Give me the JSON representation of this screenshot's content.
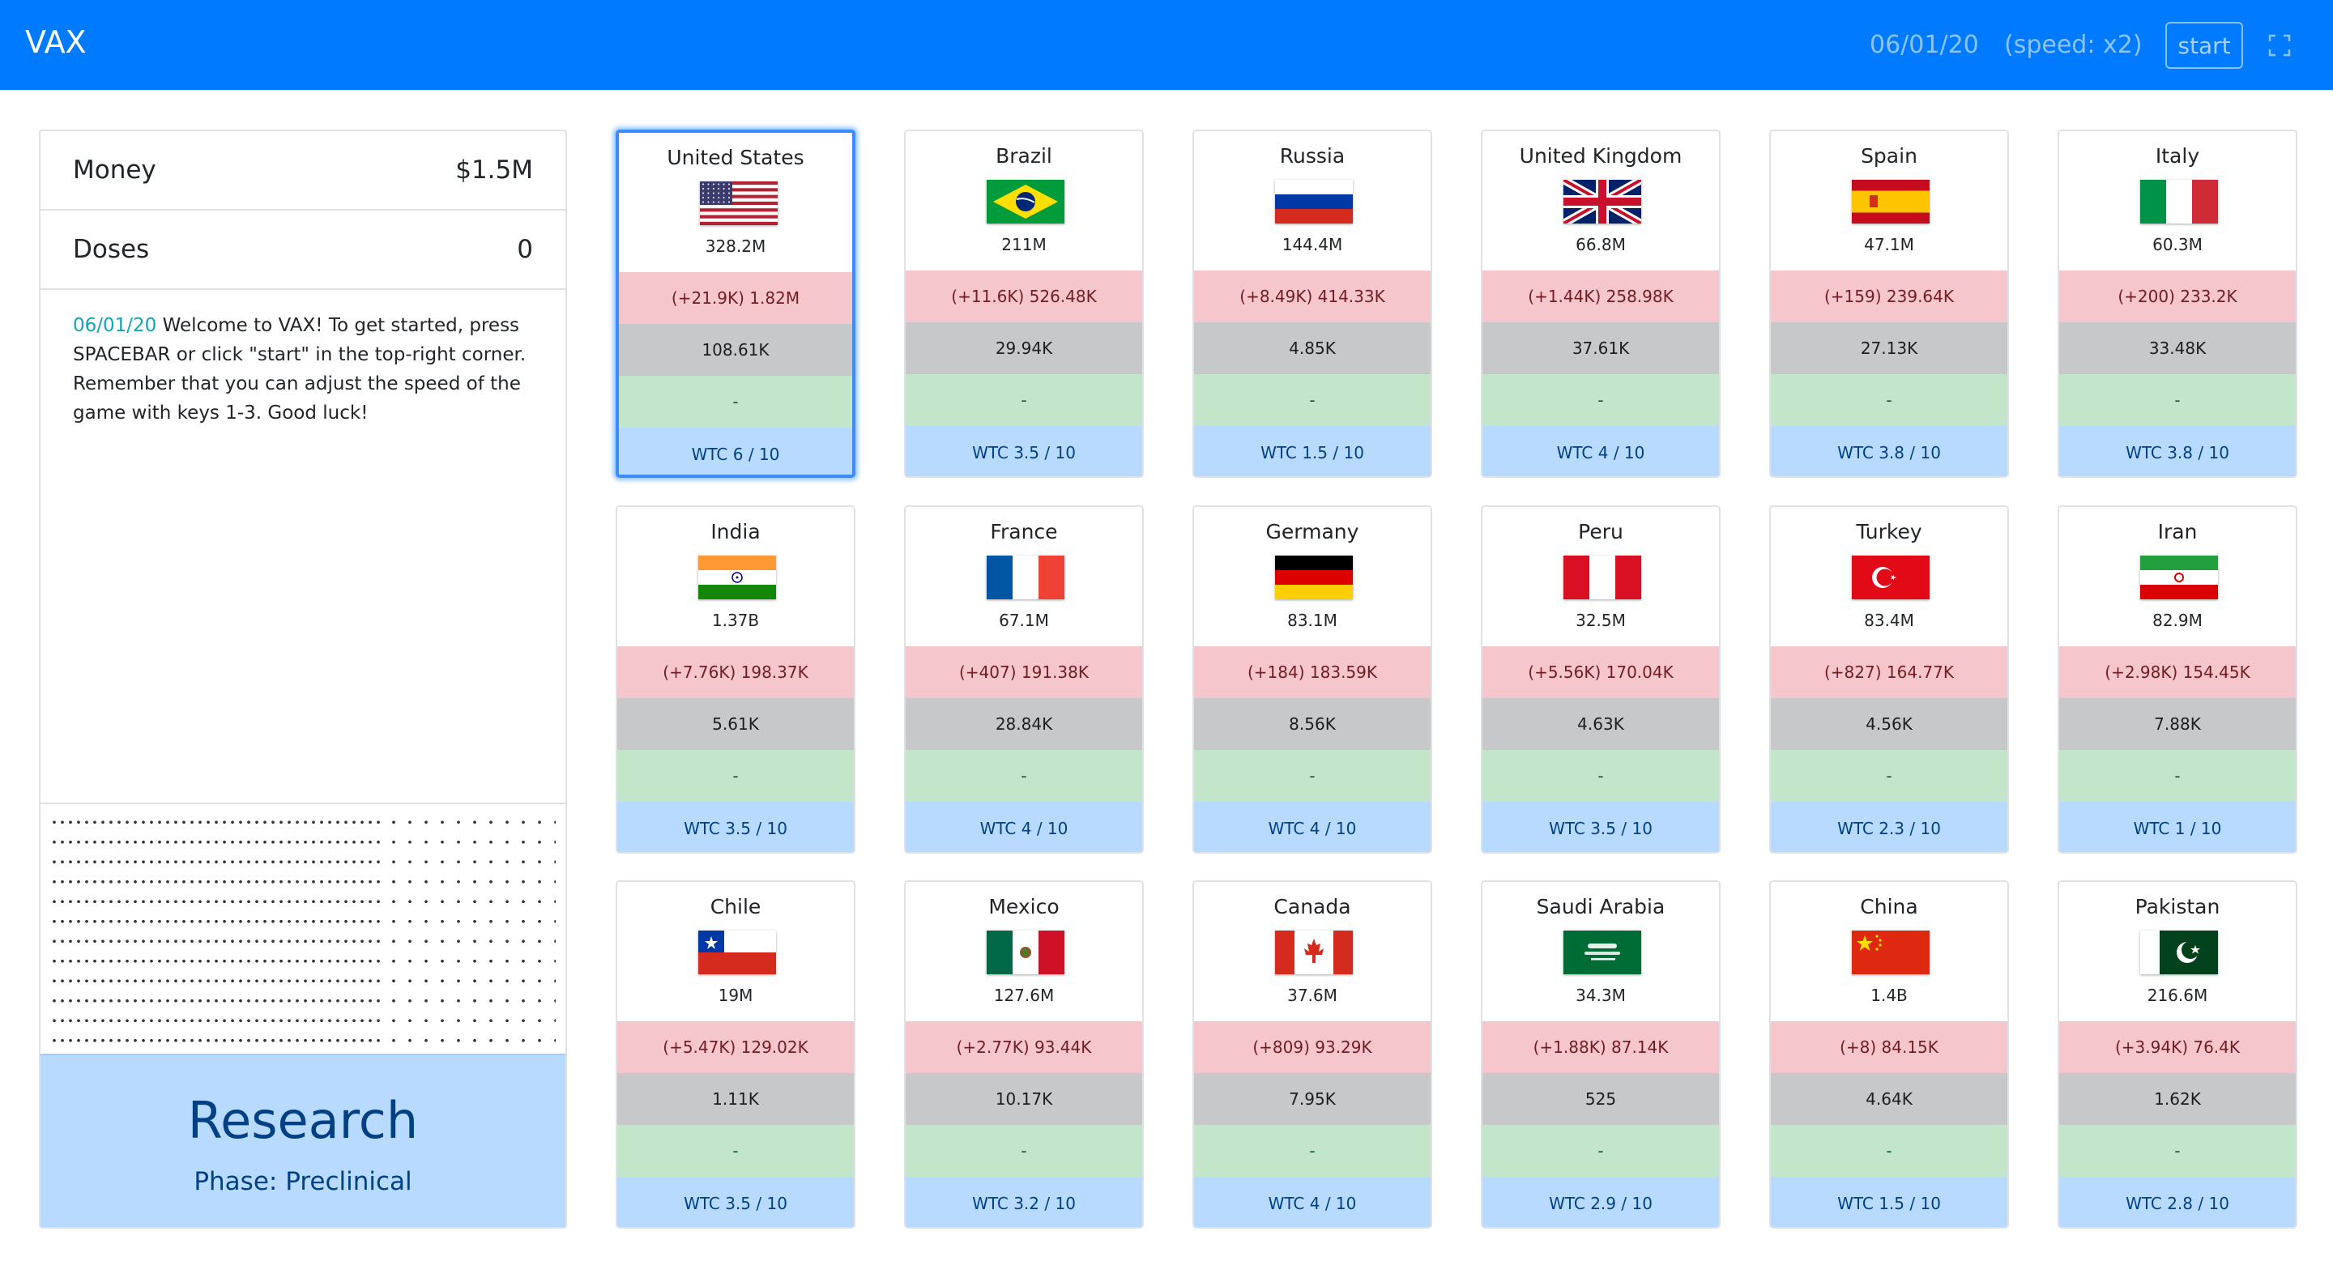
{
  "navbar": {
    "brand": "VAX",
    "date": "06/01/20",
    "speed": "(speed: x2)",
    "start_label": "start",
    "fullscreen_icon": "fullscreen-icon",
    "color": "#007bff"
  },
  "stats": {
    "money_label": "Money",
    "money_value": "$1.5M",
    "doses_label": "Doses",
    "doses_value": "0"
  },
  "log": {
    "date": "06/01/20",
    "message": " Welcome to VAX! To get started, press SPACEBAR or click \"start\" in the top-right corner. Remember that you can adjust the speed of the game with keys 1-3. Good luck!"
  },
  "research": {
    "title": "Research",
    "phase": "Phase: Preclinical"
  },
  "countries": [
    {
      "name": "United States",
      "flag": "us-flag",
      "population": "328.2M",
      "cases": "(+21.9K) 1.82M",
      "deaths": "108.61K",
      "vaccinated": "-",
      "wtc": "WTC 6 / 10",
      "selected": true
    },
    {
      "name": "Brazil",
      "flag": "brazil-flag",
      "population": "211M",
      "cases": "(+11.6K) 526.48K",
      "deaths": "29.94K",
      "vaccinated": "-",
      "wtc": "WTC 3.5 / 10"
    },
    {
      "name": "Russia",
      "flag": "russia-flag",
      "population": "144.4M",
      "cases": "(+8.49K) 414.33K",
      "deaths": "4.85K",
      "vaccinated": "-",
      "wtc": "WTC 1.5 / 10"
    },
    {
      "name": "United Kingdom",
      "flag": "uk-flag",
      "population": "66.8M",
      "cases": "(+1.44K) 258.98K",
      "deaths": "37.61K",
      "vaccinated": "-",
      "wtc": "WTC 4 / 10"
    },
    {
      "name": "Spain",
      "flag": "spain-flag",
      "population": "47.1M",
      "cases": "(+159) 239.64K",
      "deaths": "27.13K",
      "vaccinated": "-",
      "wtc": "WTC 3.8 / 10"
    },
    {
      "name": "Italy",
      "flag": "italy-flag",
      "population": "60.3M",
      "cases": "(+200) 233.2K",
      "deaths": "33.48K",
      "vaccinated": "-",
      "wtc": "WTC 3.8 / 10"
    },
    {
      "name": "India",
      "flag": "india-flag",
      "population": "1.37B",
      "cases": "(+7.76K) 198.37K",
      "deaths": "5.61K",
      "vaccinated": "-",
      "wtc": "WTC 3.5 / 10"
    },
    {
      "name": "France",
      "flag": "france-flag",
      "population": "67.1M",
      "cases": "(+407) 191.38K",
      "deaths": "28.84K",
      "vaccinated": "-",
      "wtc": "WTC 4 / 10"
    },
    {
      "name": "Germany",
      "flag": "germany-flag",
      "population": "83.1M",
      "cases": "(+184) 183.59K",
      "deaths": "8.56K",
      "vaccinated": "-",
      "wtc": "WTC 4 / 10"
    },
    {
      "name": "Peru",
      "flag": "peru-flag",
      "population": "32.5M",
      "cases": "(+5.56K) 170.04K",
      "deaths": "4.63K",
      "vaccinated": "-",
      "wtc": "WTC 3.5 / 10"
    },
    {
      "name": "Turkey",
      "flag": "turkey-flag",
      "population": "83.4M",
      "cases": "(+827) 164.77K",
      "deaths": "4.56K",
      "vaccinated": "-",
      "wtc": "WTC 2.3 / 10"
    },
    {
      "name": "Iran",
      "flag": "iran-flag",
      "population": "82.9M",
      "cases": "(+2.98K) 154.45K",
      "deaths": "7.88K",
      "vaccinated": "-",
      "wtc": "WTC 1 / 10"
    },
    {
      "name": "Chile",
      "flag": "chile-flag",
      "population": "19M",
      "cases": "(+5.47K) 129.02K",
      "deaths": "1.11K",
      "vaccinated": "-",
      "wtc": "WTC 3.5 / 10"
    },
    {
      "name": "Mexico",
      "flag": "mexico-flag",
      "population": "127.6M",
      "cases": "(+2.77K) 93.44K",
      "deaths": "10.17K",
      "vaccinated": "-",
      "wtc": "WTC 3.2 / 10"
    },
    {
      "name": "Canada",
      "flag": "canada-flag",
      "population": "37.6M",
      "cases": "(+809) 93.29K",
      "deaths": "7.95K",
      "vaccinated": "-",
      "wtc": "WTC 4 / 10"
    },
    {
      "name": "Saudi Arabia",
      "flag": "saudi-arabia-flag",
      "population": "34.3M",
      "cases": "(+1.88K) 87.14K",
      "deaths": "525",
      "vaccinated": "-",
      "wtc": "WTC 2.9 / 10"
    },
    {
      "name": "China",
      "flag": "china-flag",
      "population": "1.4B",
      "cases": "(+8) 84.15K",
      "deaths": "4.64K",
      "vaccinated": "-",
      "wtc": "WTC 1.5 / 10"
    },
    {
      "name": "Pakistan",
      "flag": "pakistan-flag",
      "population": "216.6M",
      "cases": "(+3.94K) 76.4K",
      "deaths": "1.62K",
      "vaccinated": "-",
      "wtc": "WTC 2.8 / 10"
    }
  ]
}
